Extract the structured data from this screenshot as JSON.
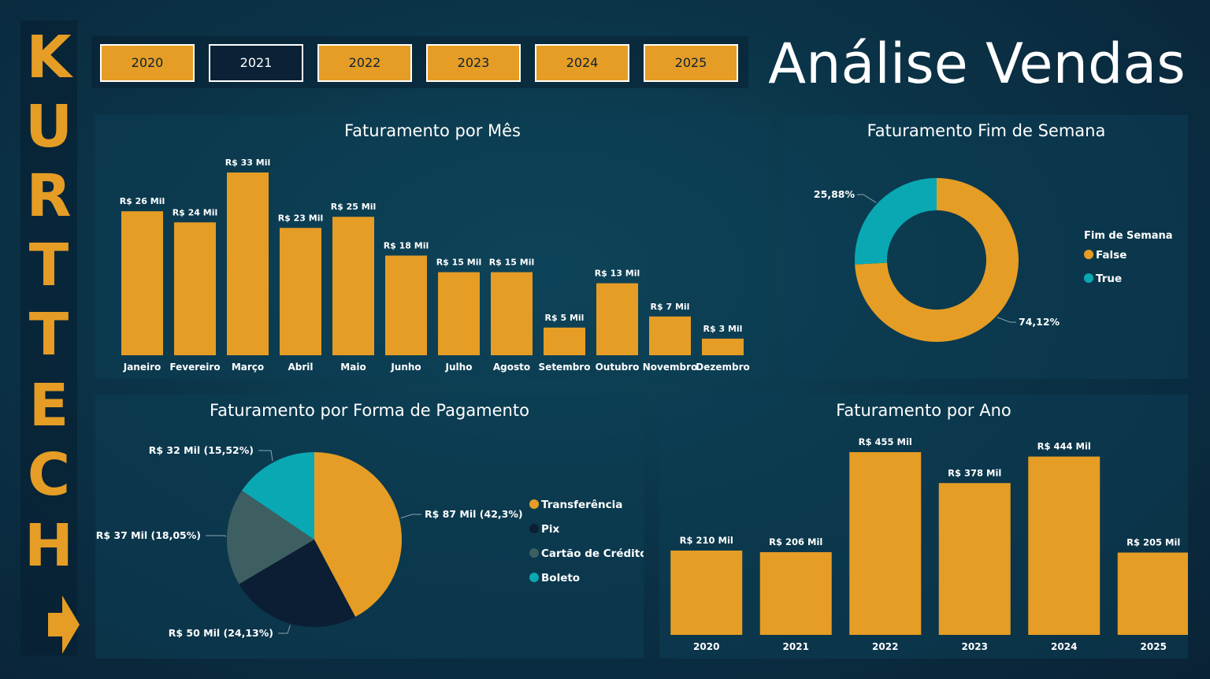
{
  "brand": {
    "letters": [
      "K",
      "U",
      "R",
      "T",
      "T",
      "E",
      "C",
      "H"
    ],
    "icon": "arrow-right-icon"
  },
  "year_filter": {
    "buttons": [
      "2020",
      "2021",
      "2022",
      "2023",
      "2024",
      "2025"
    ],
    "selected": "2021"
  },
  "page_title": "Análise Vendas",
  "colors": {
    "orange": "#e59d25",
    "teal": "#0aa8b3",
    "navy": "#0b1e33",
    "slate": "#3e5f62"
  },
  "chart_data": [
    {
      "id": "monthly",
      "type": "bar",
      "title": "Faturamento por Mês",
      "categories": [
        "Janeiro",
        "Fevereiro",
        "Março",
        "Abril",
        "Maio",
        "Junho",
        "Julho",
        "Agosto",
        "Setembro",
        "Outubro",
        "Novembro",
        "Dezembro"
      ],
      "values": [
        26,
        24,
        33,
        23,
        25,
        18,
        15,
        15,
        5,
        13,
        7,
        3
      ],
      "labels": [
        "R$ 26 Mil",
        "R$ 24 Mil",
        "R$ 33 Mil",
        "R$ 23 Mil",
        "R$ 25 Mil",
        "R$ 18 Mil",
        "R$ 15 Mil",
        "R$ 15 Mil",
        "R$ 5 Mil",
        "R$ 13 Mil",
        "R$ 7 Mil",
        "R$ 3 Mil"
      ],
      "unit": "R$ Mil",
      "ylim": [
        0,
        33
      ],
      "grid": false
    },
    {
      "id": "weekend",
      "type": "pie",
      "title": "Faturamento Fim de Semana",
      "legend_title": "Fim de Semana",
      "legend_position": "right",
      "slices": [
        {
          "name": "False",
          "value": 74.12,
          "label": "74,12%",
          "color": "#e59d25"
        },
        {
          "name": "True",
          "value": 25.88,
          "label": "25,88%",
          "color": "#0aa8b3"
        }
      ]
    },
    {
      "id": "payment",
      "type": "pie",
      "title": "Faturamento por Forma de Pagamento",
      "legend_position": "right",
      "slices": [
        {
          "name": "Transferência",
          "value": 87,
          "label": "R$ 87 Mil (42,3%)",
          "color": "#e59d25"
        },
        {
          "name": "Pix",
          "value": 50,
          "label": "R$ 50 Mil (24,13%)",
          "color": "#0b1e33"
        },
        {
          "name": "Cartão de Crédito",
          "value": 37,
          "label": "R$ 37 Mil (18,05%)",
          "color": "#3e5f62"
        },
        {
          "name": "Boleto",
          "value": 32,
          "label": "R$ 32 Mil (15,52%)",
          "color": "#0aa8b3"
        }
      ]
    },
    {
      "id": "yearly",
      "type": "bar",
      "title": "Faturamento por Ano",
      "categories": [
        "2020",
        "2021",
        "2022",
        "2023",
        "2024",
        "2025"
      ],
      "values": [
        210,
        206,
        455,
        378,
        444,
        205
      ],
      "labels": [
        "R$ 210 Mil",
        "R$ 206 Mil",
        "R$ 455 Mil",
        "R$ 378 Mil",
        "R$ 444 Mil",
        "R$ 205 Mil"
      ],
      "unit": "R$ Mil",
      "ylim": [
        0,
        455
      ],
      "grid": false
    }
  ]
}
